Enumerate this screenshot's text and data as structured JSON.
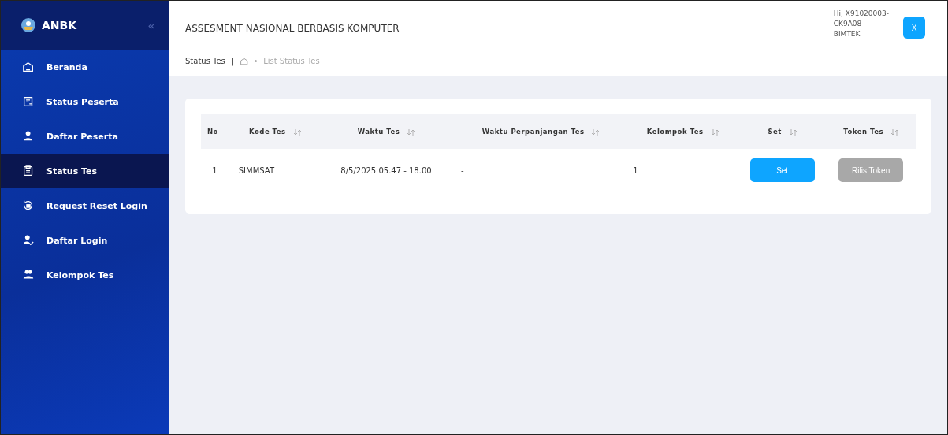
{
  "sidebar": {
    "brand": "ANBK",
    "collapse_icon": "«",
    "items": [
      {
        "label": "Beranda",
        "selected": false
      },
      {
        "label": "Status Peserta",
        "selected": false
      },
      {
        "label": "Daftar Peserta",
        "selected": false
      },
      {
        "label": "Status Tes",
        "selected": true
      },
      {
        "label": "Request Reset Login",
        "selected": false
      },
      {
        "label": "Daftar Login",
        "selected": false
      },
      {
        "label": "Kelompok Tes",
        "selected": false
      }
    ]
  },
  "header": {
    "title": "ASSESMENT NASIONAL BERBASIS KOMPUTER",
    "user_lines": [
      "Hi, X91020003-",
      "CK9A08",
      "BIMTEK"
    ],
    "user_button": "X"
  },
  "breadcrumb": {
    "page": "Status Tes",
    "separator": "|",
    "trail": "List Status Tes"
  },
  "table": {
    "columns": [
      {
        "label": "No",
        "sortable": false
      },
      {
        "label": "Kode Tes",
        "sortable": true
      },
      {
        "label": "Waktu Tes",
        "sortable": true
      },
      {
        "label": "Waktu Perpanjangan Tes",
        "sortable": true
      },
      {
        "label": "Kelompok Tes",
        "sortable": true
      },
      {
        "label": "Set",
        "sortable": true
      },
      {
        "label": "Token Tes",
        "sortable": true
      }
    ],
    "rows": [
      {
        "no": "1",
        "kode": "SIMMSAT",
        "waktu": "8/5/2025 05.47 - 18.00",
        "perpanjangan": "-",
        "kelompok": "1",
        "set_button": {
          "label": "Set",
          "disabled": false
        },
        "token_button": {
          "label": "Rilis Token",
          "disabled": true
        }
      }
    ]
  }
}
